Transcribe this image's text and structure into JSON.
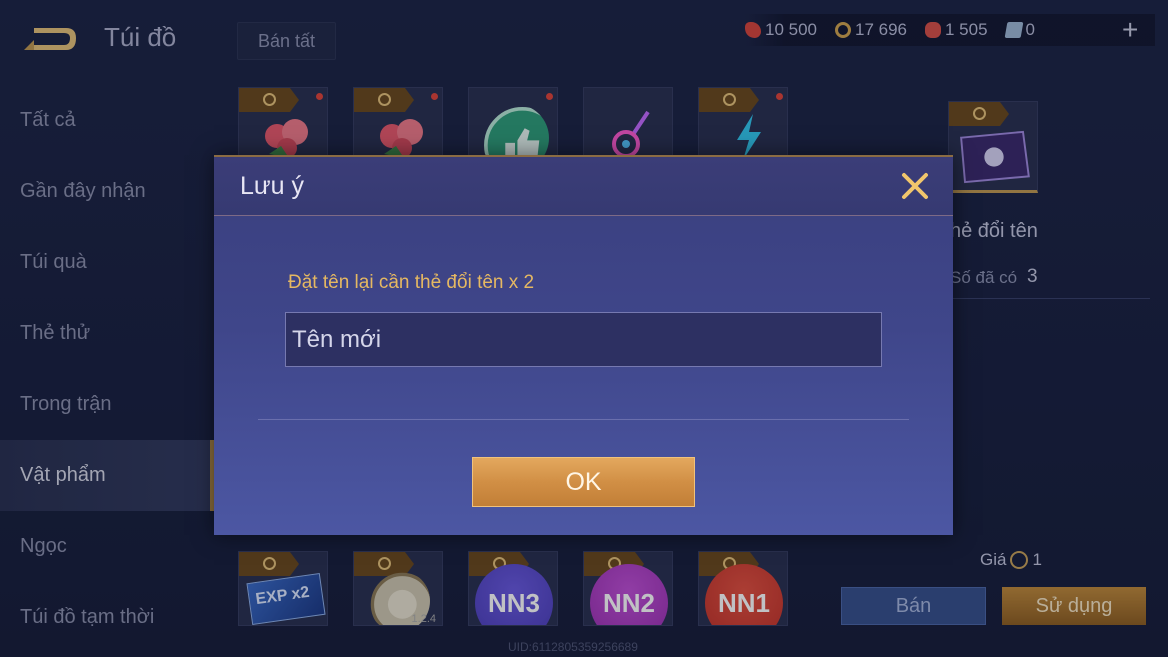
{
  "header": {
    "title": "Túi đồ",
    "sell_all": "Bán tất",
    "currencies": [
      {
        "value": "10 500",
        "icon": "red-gem-icon",
        "color": "#d8463c"
      },
      {
        "value": "17 696",
        "icon": "gold-coin-icon",
        "color": "#d2a54f"
      },
      {
        "value": "1 505",
        "icon": "red-voucher-icon",
        "color": "#d85048"
      },
      {
        "value": "0",
        "icon": "rename-card-icon",
        "color": "#9fb8d6"
      }
    ],
    "add_icon": "plus-icon"
  },
  "sidebar": {
    "items": [
      {
        "label": "Tất cả"
      },
      {
        "label": "Gần đây nhận"
      },
      {
        "label": "Túi quà"
      },
      {
        "label": "Thẻ thử"
      },
      {
        "label": "Trong trận"
      },
      {
        "label": "Vật phẩm"
      },
      {
        "label": "Ngọc"
      },
      {
        "label": "Túi đồ tạm thời"
      }
    ],
    "active": "Vật phẩm"
  },
  "items": {
    "top_row": [
      "rose-bouquet-icon",
      "rose-bouquet-icon",
      "thumbs-up-icon",
      "neon-guitar-icon",
      "lightning-icon"
    ],
    "bottom_row": [
      {
        "icon": "exp-card-icon",
        "badge": "EXP x2"
      },
      {
        "icon": "globe-icon",
        "badge": "1.2.4"
      },
      {
        "icon": "nn3-icon",
        "badge": "NN3",
        "color": "#4b3db8"
      },
      {
        "icon": "nn2-icon",
        "badge": "NN2",
        "color": "#9a2fb0"
      },
      {
        "icon": "nn1-icon",
        "badge": "NN1",
        "color": "#c23128"
      }
    ]
  },
  "detail": {
    "name": "hẻ đổi tên",
    "owned_label": "Số đã có",
    "owned_value": "3",
    "price_label": "Giá",
    "price_value": "1",
    "sell_button": "Bán",
    "use_button": "Sử dụng"
  },
  "uid": "UID:6112805359256689",
  "modal": {
    "title": "Lưu ý",
    "message": "Đặt tên lại cần thẻ đổi tên x 2",
    "input_placeholder": "Tên mới",
    "ok_label": "OK"
  }
}
